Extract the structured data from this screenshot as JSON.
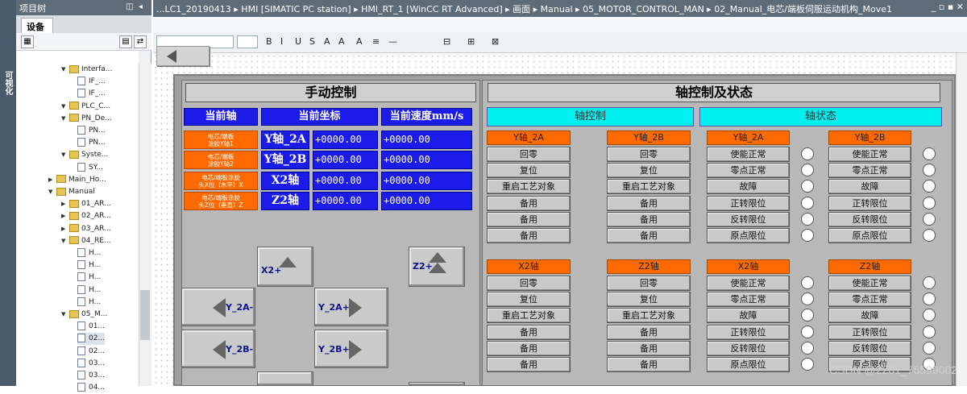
{
  "sidebar_strip": {
    "label": "可视化"
  },
  "project_tree": {
    "title": "项目树",
    "tab": "设备",
    "nodes": [
      {
        "label": "Interfa...",
        "kind": "folder",
        "expanded": true
      },
      {
        "label": "IF_...",
        "kind": "page"
      },
      {
        "label": "IF_...",
        "kind": "page"
      },
      {
        "label": "PLC_C...",
        "kind": "folder",
        "expanded": true
      },
      {
        "label": "PN_De...",
        "kind": "folder",
        "expanded": true
      },
      {
        "label": "PN...",
        "kind": "page"
      },
      {
        "label": "PN...",
        "kind": "page"
      },
      {
        "label": "Syste...",
        "kind": "folder",
        "expanded": true
      },
      {
        "label": "SY...",
        "kind": "page"
      },
      {
        "label": "Main_Ho...",
        "kind": "folder",
        "expanded": false
      },
      {
        "label": "Manual",
        "kind": "folder",
        "expanded": true
      },
      {
        "label": "01_AR...",
        "kind": "folder",
        "expanded": false
      },
      {
        "label": "02_AR...",
        "kind": "folder",
        "expanded": false
      },
      {
        "label": "03_AR...",
        "kind": "folder",
        "expanded": false
      },
      {
        "label": "04_RE...",
        "kind": "folder",
        "expanded": true
      },
      {
        "label": "H...",
        "kind": "page"
      },
      {
        "label": "H...",
        "kind": "page"
      },
      {
        "label": "H...",
        "kind": "page"
      },
      {
        "label": "H...",
        "kind": "page"
      },
      {
        "label": "H...",
        "kind": "page"
      },
      {
        "label": "05_M...",
        "kind": "folder",
        "expanded": true
      },
      {
        "label": "01...",
        "kind": "page"
      },
      {
        "label": "02...",
        "kind": "page",
        "selected": true
      },
      {
        "label": "02...",
        "kind": "page"
      },
      {
        "label": "03...",
        "kind": "page"
      },
      {
        "label": "03...",
        "kind": "page"
      },
      {
        "label": "04...",
        "kind": "page"
      }
    ]
  },
  "breadcrumb": "...LC1_20190413 ▸ HMI [SIMATIC PC station] ▸ HMI_RT_1 [WinCC RT Advanced] ▸ 画面 ▸ Manual ▸ 05_MOTOR_CONTROL_MAN ▸ 02_Manual_电芯/端板伺服运动机构_Move1",
  "window_controls": "_ ▫ ▪ ✕",
  "format_toolbar": [
    "B",
    "I",
    "U",
    "S",
    "A",
    "A",
    "A",
    "≡",
    "—",
    "⊟",
    "⊞",
    "⊠"
  ],
  "hmi": {
    "manual": {
      "title": "手动控制",
      "headers": [
        "当前轴",
        "当前坐标",
        "当前速度mm/s"
      ],
      "rows": [
        {
          "button": "电芯/端板\n涂胶Y轴1",
          "axis": "Y轴_2A",
          "pos": "+0000.00",
          "speed": "+0000.00"
        },
        {
          "button": "电芯/端板\n涂胶Y轴2",
          "axis": "Y轴_2B",
          "pos": "+0000.00",
          "speed": "+0000.00"
        },
        {
          "button": "电芯/端板涂胶\n头X位（水平）X",
          "axis": "X2轴",
          "pos": "+0000.00",
          "speed": "+0000.00"
        },
        {
          "button": "电芯/端板涂胶\n头Z位（垂直）Z",
          "axis": "Z2轴",
          "pos": "+0000.00",
          "speed": "+0000.00"
        }
      ],
      "jog": {
        "x2_plus": "X2+",
        "z2_plus": "Z2+",
        "y2a_minus": "Y_2A-",
        "y2a_plus": "Y_2A+",
        "y2b_minus": "Y_2B-",
        "y2b_plus": "Y_2B+"
      }
    },
    "axis": {
      "title": "轴控制及状态",
      "control_header": "轴控制",
      "status_header": "轴状态",
      "control_groups": [
        {
          "name": "Y轴_2A",
          "buttons": [
            "回零",
            "复位",
            "重启工艺对象",
            "备用",
            "备用",
            "备用"
          ]
        },
        {
          "name": "Y轴_2B",
          "buttons": [
            "回零",
            "复位",
            "重启工艺对象",
            "备用",
            "备用",
            "备用"
          ]
        },
        {
          "name": "X2轴",
          "buttons": [
            "回零",
            "复位",
            "重启工艺对象",
            "备用",
            "备用",
            "备用"
          ]
        },
        {
          "name": "Z2轴",
          "buttons": [
            "回零",
            "复位",
            "重启工艺对象",
            "备用",
            "备用",
            "备用"
          ]
        }
      ],
      "status_groups": [
        {
          "name": "Y轴_2A",
          "items": [
            "使能正常",
            "零点正常",
            "故障",
            "正转限位",
            "反转限位",
            "原点限位"
          ]
        },
        {
          "name": "Y轴_2B",
          "items": [
            "使能正常",
            "零点正常",
            "故障",
            "正转限位",
            "反转限位",
            "原点限位"
          ]
        },
        {
          "name": "X2轴",
          "items": [
            "使能正常",
            "零点正常",
            "故障",
            "正转限位",
            "反转限位",
            "原点限位"
          ]
        },
        {
          "name": "Z2轴",
          "items": [
            "使能正常",
            "零点正常",
            "故障",
            "正转限位",
            "反转限位",
            "原点限位"
          ]
        }
      ]
    }
  },
  "watermark": "CSDN @2201_75599002",
  "colors": {
    "accent_blue": "#1b1bea",
    "orange": "#ff6a00",
    "cyan": "#00f0f0",
    "panel_gray": "#b8b8b8"
  }
}
